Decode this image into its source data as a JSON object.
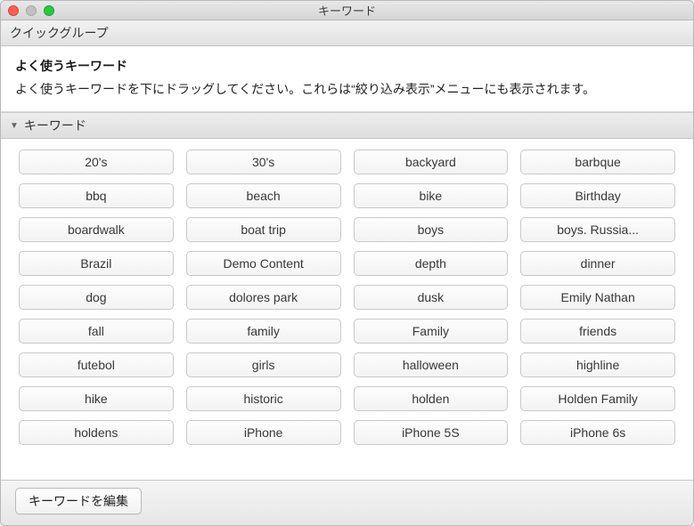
{
  "window": {
    "title": "キーワード"
  },
  "quick_group_header": "クイックグループ",
  "intro": {
    "title": "よく使うキーワード",
    "desc": "よく使うキーワードを下にドラッグしてください。これらは“絞り込み表示”メニューにも表示されます。"
  },
  "keywords_header": "キーワード",
  "keywords": [
    "20's",
    "30's",
    "backyard",
    "barbque",
    "bbq",
    "beach",
    "bike",
    "Birthday",
    "boardwalk",
    "boat trip",
    "boys",
    "boys. Russia...",
    "Brazil",
    "Demo Content",
    "depth",
    "dinner",
    "dog",
    "dolores park",
    "dusk",
    "Emily Nathan",
    "fall",
    "family",
    "Family",
    "friends",
    "futebol",
    "girls",
    "halloween",
    "highline",
    "hike",
    "historic",
    "holden",
    "Holden Family",
    "holdens",
    "iPhone",
    "iPhone 5S",
    "iPhone 6s"
  ],
  "footer": {
    "edit_label": "キーワードを編集"
  }
}
